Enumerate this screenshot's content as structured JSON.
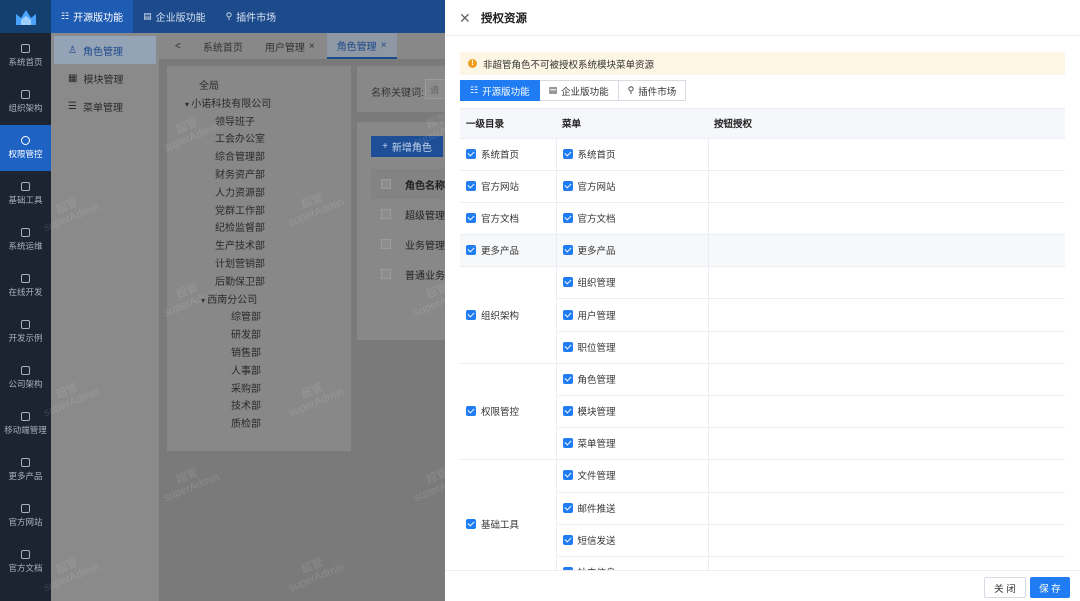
{
  "sidebar": {
    "items": [
      {
        "label": "系统首页",
        "icon": "home-icon"
      },
      {
        "label": "组织架构",
        "icon": "org-icon"
      },
      {
        "label": "权限管控",
        "icon": "lock-icon",
        "active": true
      },
      {
        "label": "基础工具",
        "icon": "wrench-icon"
      },
      {
        "label": "系统运维",
        "icon": "doc-icon"
      },
      {
        "label": "在线开发",
        "icon": "code-icon"
      },
      {
        "label": "开发示例",
        "icon": "sample-icon"
      },
      {
        "label": "公司架构",
        "icon": "company-icon"
      },
      {
        "label": "移动端管理",
        "icon": "mobile-icon"
      },
      {
        "label": "更多产品",
        "icon": "bag-icon"
      },
      {
        "label": "官方网站",
        "icon": "globe-icon"
      },
      {
        "label": "官方文档",
        "icon": "book-icon"
      }
    ]
  },
  "topbar": {
    "items": [
      {
        "label": "开源版功能",
        "active": true
      },
      {
        "label": "企业版功能"
      },
      {
        "label": "插件市场"
      }
    ]
  },
  "submenu": {
    "items": [
      {
        "label": "角色管理",
        "active": true
      },
      {
        "label": "模块管理"
      },
      {
        "label": "菜单管理"
      }
    ]
  },
  "tabs": {
    "items": [
      {
        "label": "系统首页"
      },
      {
        "label": "用户管理"
      },
      {
        "label": "角色管理",
        "active": true
      }
    ],
    "close": "×",
    "back": "<"
  },
  "tree": {
    "nodes": [
      {
        "label": "全局",
        "level": 0
      },
      {
        "label": "小诺科技有限公司",
        "level": 1,
        "expanded": true
      },
      {
        "label": "领导班子",
        "level": 2
      },
      {
        "label": "工会办公室",
        "level": 2
      },
      {
        "label": "综合管理部",
        "level": 2
      },
      {
        "label": "财务资产部",
        "level": 2
      },
      {
        "label": "人力资源部",
        "level": 2
      },
      {
        "label": "党群工作部",
        "level": 2
      },
      {
        "label": "纪检监督部",
        "level": 2
      },
      {
        "label": "生产技术部",
        "level": 2
      },
      {
        "label": "计划营销部",
        "level": 2
      },
      {
        "label": "后勤保卫部",
        "level": 2
      },
      {
        "label": "西南分公司",
        "level": 2,
        "expanded": true
      },
      {
        "label": "综管部",
        "level": 3
      },
      {
        "label": "研发部",
        "level": 3
      },
      {
        "label": "销售部",
        "level": 3
      },
      {
        "label": "人事部",
        "level": 3
      },
      {
        "label": "采购部",
        "level": 3
      },
      {
        "label": "技术部",
        "level": 3
      },
      {
        "label": "质检部",
        "level": 3
      }
    ]
  },
  "filter": {
    "label": "名称关键词:",
    "placeholder": "请"
  },
  "roles": {
    "add_label": "新增角色",
    "header": "角色名称",
    "rows": [
      "超级管理",
      "业务管理",
      "普通业务"
    ]
  },
  "watermark": {
    "line1": "超管",
    "line2": "superAdmin"
  },
  "drawer": {
    "title": "授权资源",
    "alert": "非超管角色不可被授权系统模块菜单资源",
    "segments": [
      {
        "label": "开源版功能",
        "active": true
      },
      {
        "label": "企业版功能"
      },
      {
        "label": "插件市场"
      }
    ],
    "columns": [
      "一级目录",
      "菜单",
      "按钮授权"
    ],
    "groups": [
      {
        "name": "系统首页",
        "menus": [
          "系统首页"
        ]
      },
      {
        "name": "官方网站",
        "menus": [
          "官方网站"
        ]
      },
      {
        "name": "官方文档",
        "menus": [
          "官方文档"
        ]
      },
      {
        "name": "更多产品",
        "menus": [
          "更多产品"
        ]
      },
      {
        "name": "组织架构",
        "menus": [
          "组织管理",
          "用户管理",
          "职位管理"
        ]
      },
      {
        "name": "权限管控",
        "menus": [
          "角色管理",
          "模块管理",
          "菜单管理"
        ]
      },
      {
        "name": "基础工具",
        "menus": [
          "文件管理",
          "邮件推送",
          "短信发送",
          "站内信息"
        ]
      }
    ],
    "close_label": "关 闭",
    "save_label": "保 存"
  },
  "colors": {
    "primary": "#1f7cf2",
    "sidebar_bg": "#1d2431",
    "alert_bg": "#fdf6e4",
    "alert_icon": "#f0a020"
  }
}
